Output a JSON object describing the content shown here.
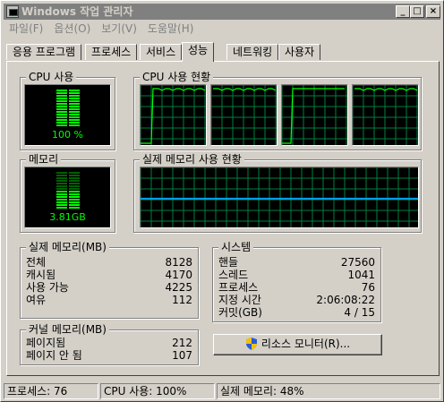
{
  "window": {
    "title": "Windows 작업 관리자"
  },
  "menu": [
    "파일(F)",
    "옵션(O)",
    "보기(V)",
    "도움말(H)"
  ],
  "tabs": [
    "응용 프로그램",
    "프로세스",
    "서비스",
    "성능",
    "네트워킹",
    "사용자"
  ],
  "active_tab": "성능",
  "cpu": {
    "label": "CPU 사용",
    "value": "100 %",
    "level": 1.0
  },
  "cpu_history": {
    "label": "CPU 사용 현황"
  },
  "memory": {
    "label": "메모리",
    "value": "3.81GB",
    "level": 0.48
  },
  "memory_history": {
    "label": "실제 메모리 사용 현황",
    "level": 0.48
  },
  "physical_memory": {
    "label": "실제 메모리(MB)",
    "rows": [
      {
        "key": "전체",
        "value": "8128"
      },
      {
        "key": "캐시됨",
        "value": "4170"
      },
      {
        "key": "사용 가능",
        "value": "4225"
      },
      {
        "key": "여유",
        "value": "112"
      }
    ]
  },
  "kernel_memory": {
    "label": "커널 메모리(MB)",
    "rows": [
      {
        "key": "페이지됨",
        "value": "212"
      },
      {
        "key": "페이지 안 됨",
        "value": "107"
      }
    ]
  },
  "system": {
    "label": "시스템",
    "rows": [
      {
        "key": "핸들",
        "value": "27560"
      },
      {
        "key": "스레드",
        "value": "1041"
      },
      {
        "key": "프로세스",
        "value": "76"
      },
      {
        "key": "지정 시간",
        "value": "2:06:08:22"
      },
      {
        "key": "커밋(GB)",
        "value": "4 / 15"
      }
    ]
  },
  "resource_monitor_button": "리소스 모니터(R)...",
  "status": {
    "processes": "프로세스: 76",
    "cpu": "CPU 사용: 100%",
    "memory": "실제 메모리: 48%"
  },
  "colors": {
    "graph_line": "#00ff00",
    "memory_line": "#00a0ff",
    "grid": "#008040"
  }
}
